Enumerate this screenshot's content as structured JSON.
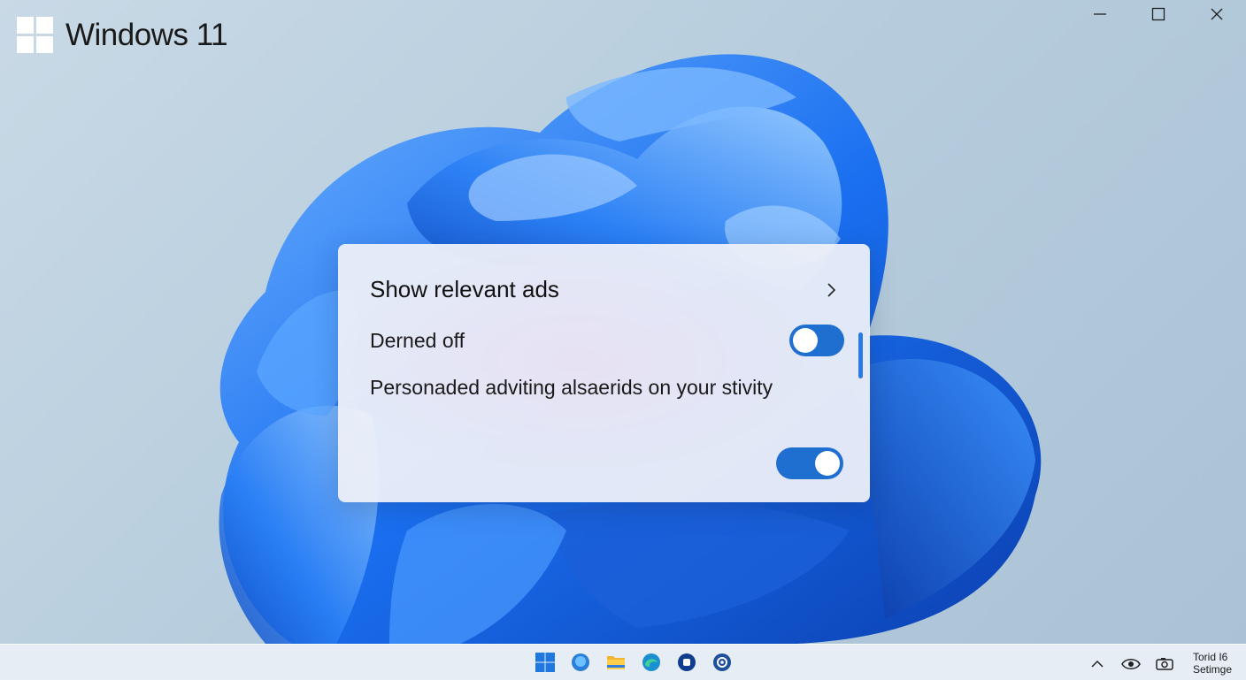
{
  "brand": {
    "title": "Windows 11",
    "logo_icon": "windows-logo-icon"
  },
  "window_controls": {
    "icons": [
      "minimize-icon",
      "maximize-icon",
      "close-icon"
    ]
  },
  "card": {
    "title": "Show relevant ads",
    "status": "Derned off",
    "description": "Personaded adviting alsaerids on your stivity",
    "toggle1_on": true,
    "toggle2_on": true
  },
  "taskbar": {
    "icons": [
      "start-icon",
      "chat-icon",
      "file-explorer-icon",
      "edge-icon",
      "store-icon",
      "settings-icon"
    ],
    "tray_icons": [
      "chevron-up-icon",
      "eye-icon",
      "camera-icon"
    ]
  },
  "clock": {
    "line1": "Torid I6",
    "line2": "Setimge"
  },
  "colors": {
    "accent": "#1f6fd1",
    "card_bg": "#eef0f8",
    "taskbar_bg": "#e8eef5"
  }
}
